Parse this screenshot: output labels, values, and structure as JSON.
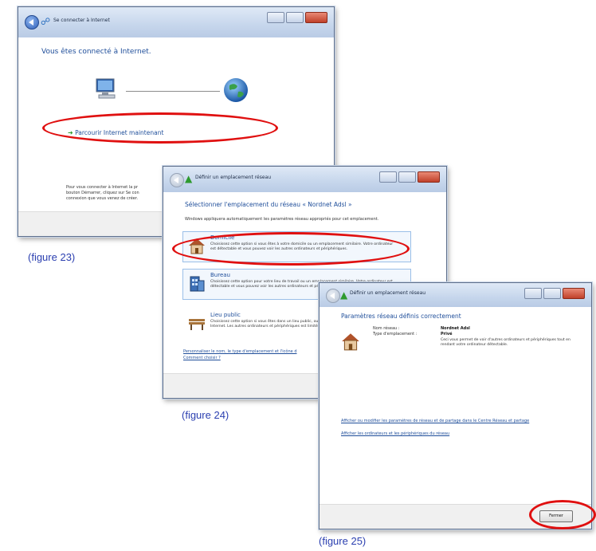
{
  "window1": {
    "title": "Se connecter à Internet",
    "heading": "Vous êtes connecté à Internet.",
    "browse_link": "Parcourir Internet maintenant",
    "footer_text_lines": [
      "Pour vous connecter à Internet la pr",
      "bouton Démarrer, cliquez sur Se con",
      "connexion que vous venez de créer."
    ]
  },
  "window2": {
    "title": "Définir un emplacement réseau",
    "heading": "Sélectionner l'emplacement du réseau « Nordnet Adsl »",
    "subtext": "Windows appliquera automatiquement les paramètres réseau appropriés pour cet emplacement.",
    "options": [
      {
        "title": "Domicile",
        "desc": "Choisissez cette option si vous êtes à votre domicile ou un emplacement similaire. Votre ordinateur est détectable et vous pouvez voir les autres ordinateurs et périphériques."
      },
      {
        "title": "Bureau",
        "desc": "Choisissez cette option pour votre lieu de travail ou un emplacement similaire. Votre ordinateur est détectable et vous pouvez voir les autres ordinateurs et périphériques."
      },
      {
        "title": "Lieu public",
        "desc": "Choisissez cette option si vous êtes dans un lieu public, ou si vous êtes connecté directement à Internet. Les autres ordinateurs et périphériques est limité."
      }
    ],
    "link_customize": "Personnaliser le nom, le type d'emplacement et l'icône d",
    "link_help": "Comment choisir ?"
  },
  "window3": {
    "title": "Définir un emplacement réseau",
    "heading": "Paramètres réseau définis correctement",
    "name_label": "Nom réseau :",
    "name_value": "Nordnet Adsl",
    "type_label": "Type d'emplacement :",
    "type_value": "Privé",
    "type_desc": "Ceci vous permet de voir d'autres ordinateurs et périphériques tout en rendant votre ordinateur détectable.",
    "link_settings": "Afficher ou modifier les paramètres de réseau et de partage dans le Centre Réseau et partage",
    "link_devices": "Afficher les ordinateurs et les périphériques du réseau",
    "close_button": "Fermer"
  },
  "captions": {
    "fig23": "(figure 23)",
    "fig24": "(figure 24)",
    "fig25": "(figure 25)"
  },
  "annotation_color": "#e01010",
  "caption_color": "#2b3fb0"
}
